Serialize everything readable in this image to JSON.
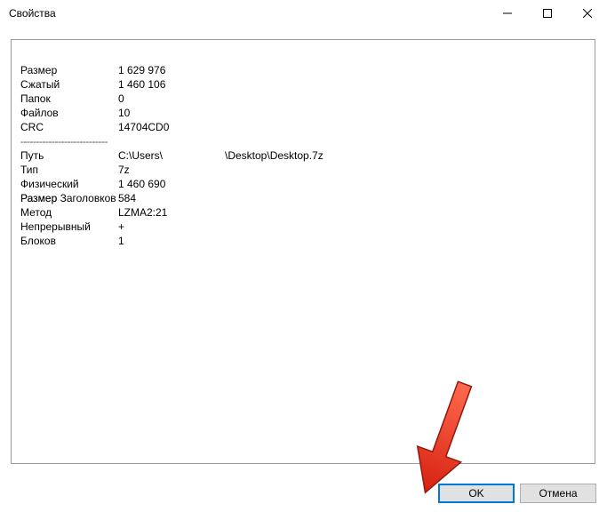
{
  "window": {
    "title": "Свойства"
  },
  "props": {
    "size_label": "Размер",
    "size_value": "1 629 976",
    "packed_label": "Сжатый",
    "packed_value": "1 460 106",
    "folders_label": "Папок",
    "folders_value": "0",
    "files_label": "Файлов",
    "files_value": "10",
    "crc_label": "CRC",
    "crc_value": "14704CD0",
    "divider": "----------------------------",
    "path_label": "Путь",
    "path_value1": "C:\\Users\\",
    "path_value2": "\\Desktop\\Desktop.7z",
    "type_label": "Тип",
    "type_value": "7z",
    "physical_label": "Физический Размер",
    "physical_value": "1 460 690",
    "headers_label": "Размер Заголовков",
    "headers_value": "584",
    "method_label": "Метод",
    "method_value": "LZMA2:21",
    "solid_label": "Непрерывный",
    "solid_value": "+",
    "blocks_label": "Блоков",
    "blocks_value": "1"
  },
  "buttons": {
    "ok": "OK",
    "cancel": "Отмена"
  }
}
